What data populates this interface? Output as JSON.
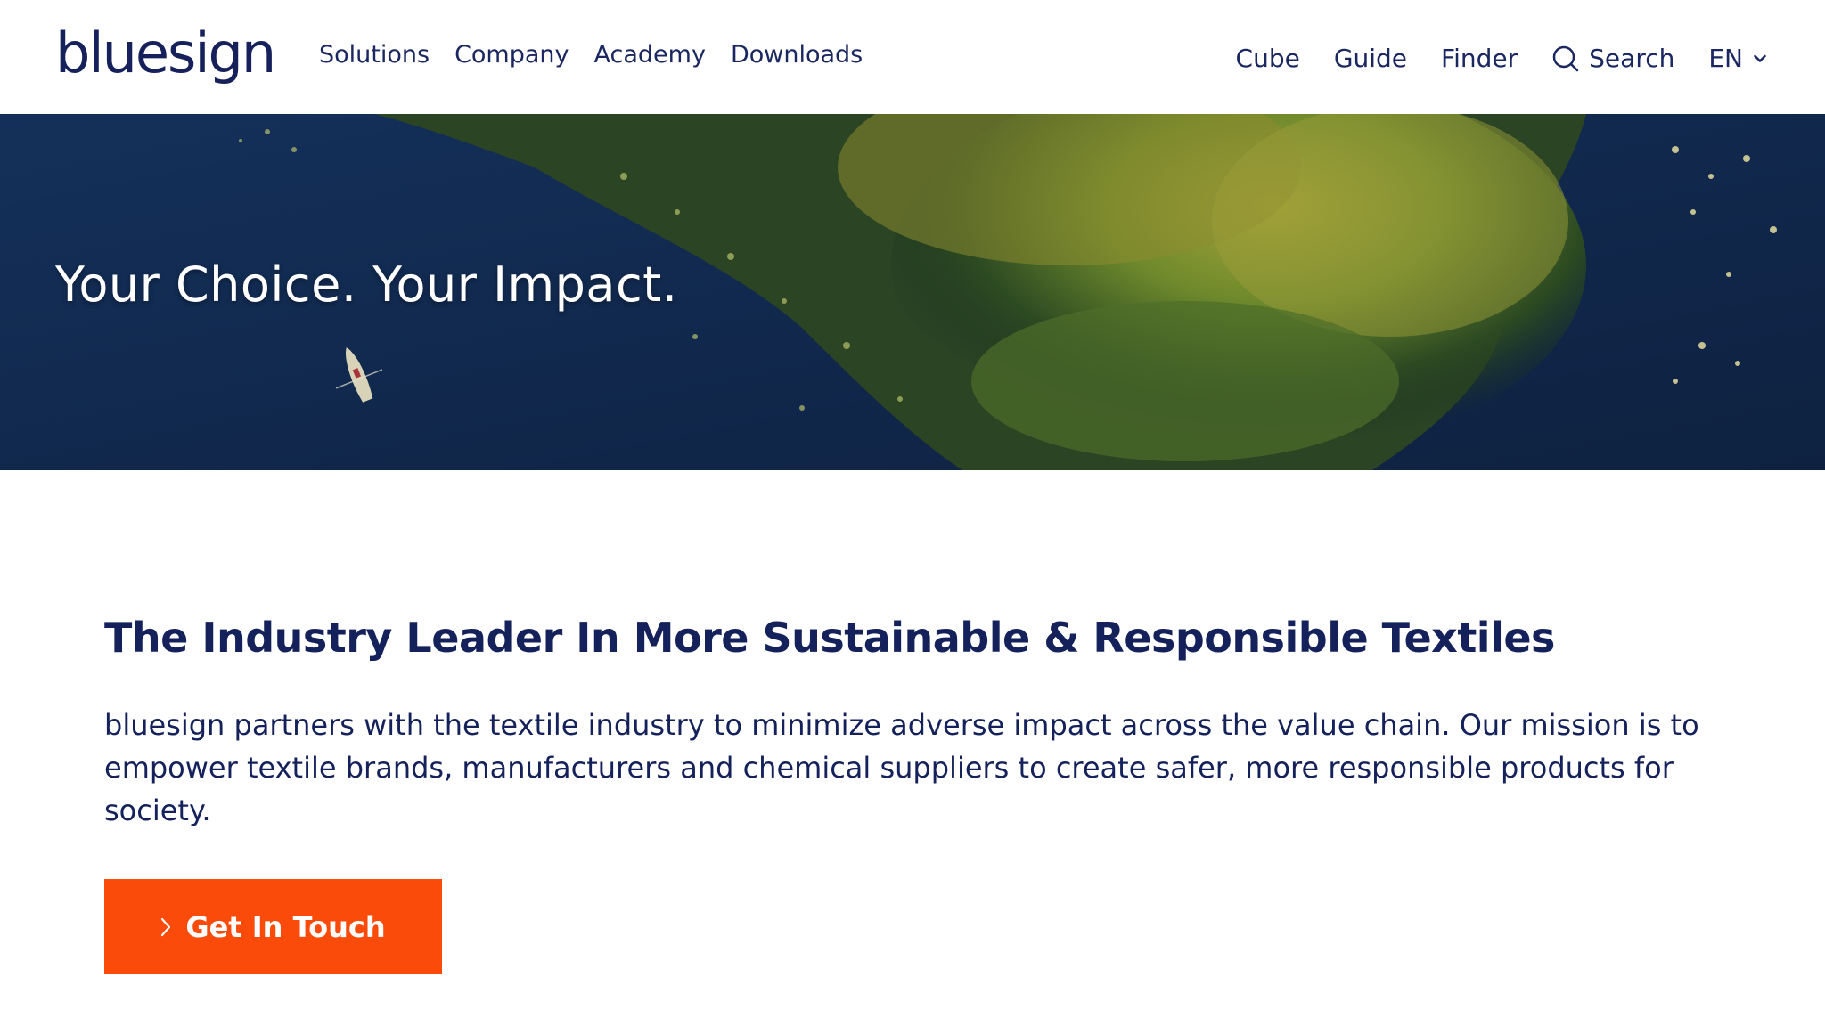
{
  "brand": {
    "logo_text": "bluesign"
  },
  "nav": {
    "items": [
      {
        "label": "Solutions"
      },
      {
        "label": "Company"
      },
      {
        "label": "Academy"
      },
      {
        "label": "Downloads"
      }
    ]
  },
  "nav_right": {
    "items": [
      {
        "label": "Cube"
      },
      {
        "label": "Guide"
      },
      {
        "label": "Finder"
      }
    ],
    "search_label": "Search",
    "language": "EN"
  },
  "hero": {
    "title": "Your Choice. Your Impact.",
    "image_alt": "aerial lake forest boat"
  },
  "main": {
    "headline": "The Industry Leader In More Sustainable & Responsible Textiles",
    "lead": "bluesign partners with the textile industry to minimize adverse impact across the value chain. Our mission is to empower textile brands, manufacturers and chemical suppliers to create safer, more responsible products for society.",
    "cta_label": "Get In Touch"
  },
  "colors": {
    "brand_navy": "#14215a",
    "accent_orange": "#fb4b0a",
    "background": "#ffffff"
  },
  "icons": [
    "search-icon",
    "chevron-down-icon",
    "chevron-right-icon"
  ]
}
